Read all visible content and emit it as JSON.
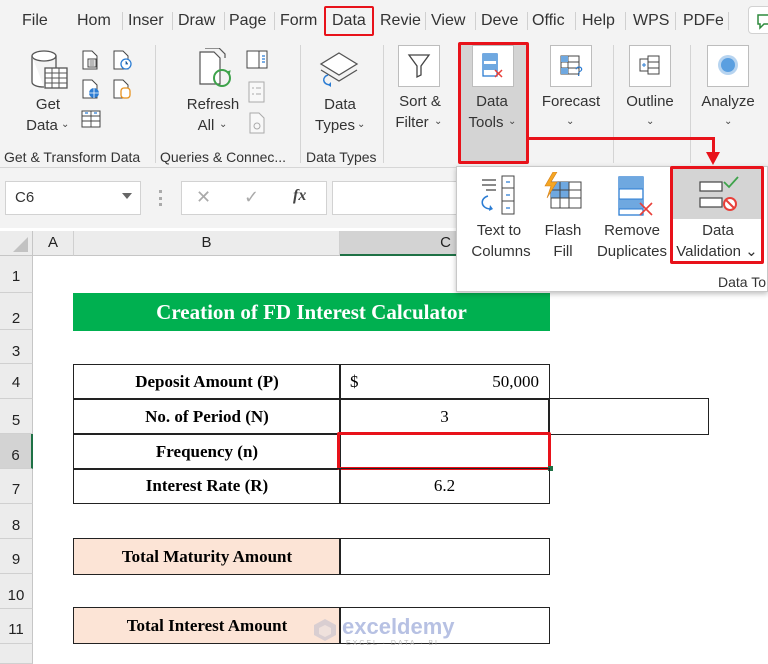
{
  "ribbon_tabs": [
    {
      "label": "File"
    },
    {
      "label": "Hom"
    },
    {
      "label": "Inser"
    },
    {
      "label": "Draw"
    },
    {
      "label": "Page"
    },
    {
      "label": "Form"
    },
    {
      "label": "Data",
      "active": true
    },
    {
      "label": "Revie"
    },
    {
      "label": "View"
    },
    {
      "label": "Deve"
    },
    {
      "label": "Offic"
    },
    {
      "label": "Help"
    },
    {
      "label": "WPS"
    },
    {
      "label": "PDFe"
    }
  ],
  "ribbon": {
    "get_data": {
      "line1": "Get",
      "line2": "Data",
      "chevron": "⌄"
    },
    "refresh_all": {
      "line1": "Refresh",
      "line2": "All",
      "chevron": "⌄"
    },
    "data_types": {
      "line1": "Data",
      "line2": "Types",
      "chevron": "⌄"
    },
    "sort_filter": {
      "line1": "Sort &",
      "line2": "Filter",
      "chevron": "⌄"
    },
    "data_tools": {
      "line1": "Data",
      "line2": "Tools",
      "chevron": "⌄"
    },
    "forecast": {
      "line1": "Forecast",
      "chevron": "⌄"
    },
    "outline": {
      "line1": "Outline",
      "chevron": "⌄"
    },
    "analyze": {
      "line1": "Analyze",
      "chevron": "⌄"
    },
    "groups": {
      "get_transform": "Get & Transform Data",
      "queries": "Queries & Connec...",
      "data_types": "Data Types"
    }
  },
  "data_tools_panel": {
    "text_to_columns": {
      "line1": "Text to",
      "line2": "Columns"
    },
    "flash_fill": {
      "line1": "Flash",
      "line2": "Fill"
    },
    "remove_duplicates": {
      "line1": "Remove",
      "line2": "Duplicates"
    },
    "data_validation": {
      "line1": "Data",
      "line2": "Validation ⌄"
    },
    "group_label": "Data To"
  },
  "formula_bar": {
    "name_box": "C6",
    "cancel_icon": "✕",
    "enter_icon": "✓",
    "fx_label": "fx",
    "formula": ""
  },
  "columns": [
    "A",
    "B",
    "C"
  ],
  "rows": [
    "1",
    "2",
    "3",
    "4",
    "5",
    "6",
    "7",
    "8",
    "9",
    "10",
    "11"
  ],
  "sheet": {
    "title": "Creation of FD Interest Calculator",
    "title_bg": "#00b050",
    "deposit_label": "Deposit Amount (P)",
    "deposit_currency": "$",
    "deposit_value": "50,000",
    "period_label": "No. of Period (N)",
    "period_value": "3",
    "frequency_label": "Frequency (n)",
    "frequency_value": "",
    "rate_label": "Interest Rate (R)",
    "rate_value": "6.2",
    "maturity_label": "Total Maturity Amount",
    "maturity_value": "",
    "interest_label": "Total Interest Amount",
    "interest_value": ""
  },
  "watermark": {
    "brand": "exceldemy",
    "tagline": "EXCEL · DATA · BI"
  },
  "highlight_color": "#e8121a"
}
